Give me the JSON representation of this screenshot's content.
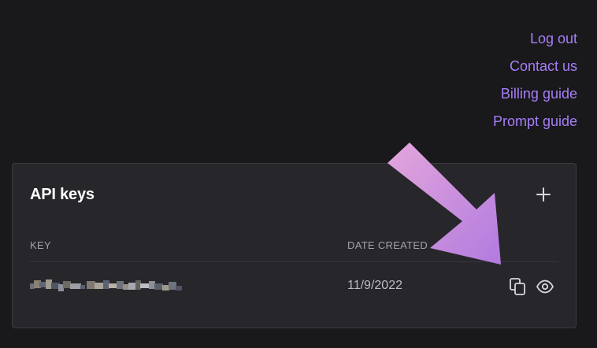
{
  "nav_links": {
    "logout": "Log out",
    "contact": "Contact us",
    "billing": "Billing guide",
    "prompt": "Prompt guide"
  },
  "api_keys": {
    "title": "API keys",
    "columns": {
      "key": "KEY",
      "date_created": "DATE CREATED"
    },
    "rows": [
      {
        "date_created": "11/9/2022"
      }
    ]
  },
  "icons": {
    "add": "plus-icon",
    "copy": "copy-icon",
    "view": "eye-icon",
    "annotation": "arrow-icon"
  },
  "colors": {
    "background": "#19181b",
    "panel": "#27262a",
    "link": "#a77ef7",
    "arrow_top": "#e3a6db",
    "arrow_bottom": "#b27ae0"
  }
}
